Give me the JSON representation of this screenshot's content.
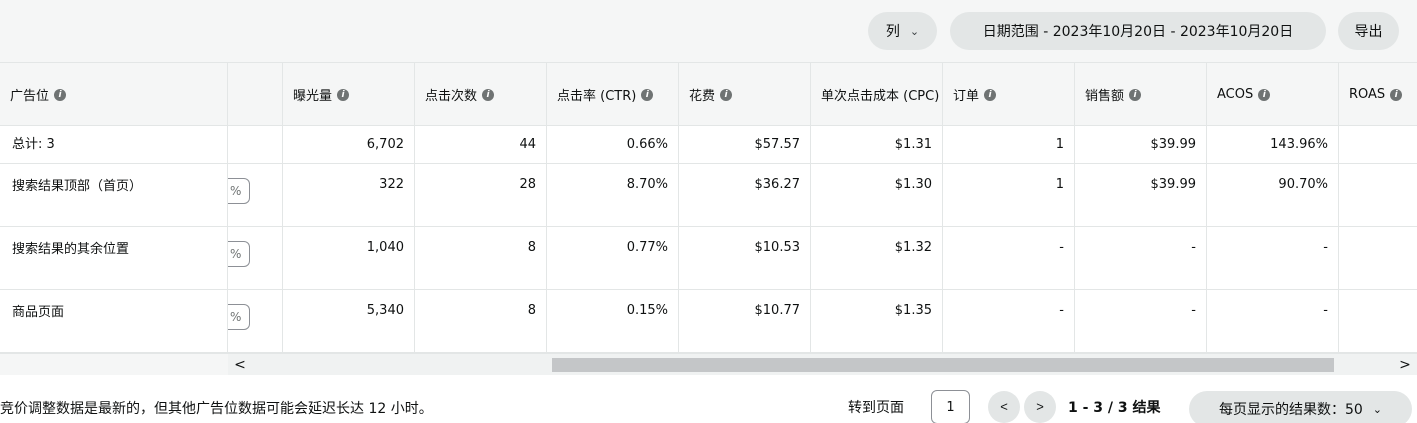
{
  "toolbar": {
    "columns_label": "列",
    "date_range_label": "日期范围 - 2023年10月20日 - 2023年10月20日",
    "export_label": "导出"
  },
  "table": {
    "headers": [
      "广告位",
      "",
      "曝光量",
      "点击次数",
      "点击率 (CTR)",
      "花费",
      "单次点击成本 (CPC)",
      "订单",
      "销售额",
      "ACOS",
      "ROAS"
    ],
    "total": {
      "label": "总计: 3",
      "values": [
        "6,702",
        "44",
        "0.66%",
        "$57.57",
        "$1.31",
        "1",
        "$39.99",
        "143.96%",
        ""
      ]
    },
    "rows": [
      {
        "placement": "搜索结果顶部（首页）",
        "bid_adjust": "%",
        "values": [
          "322",
          "28",
          "8.70%",
          "$36.27",
          "$1.30",
          "1",
          "$39.99",
          "90.70%",
          ""
        ]
      },
      {
        "placement": "搜索结果的其余位置",
        "bid_adjust": "%",
        "values": [
          "1,040",
          "8",
          "0.77%",
          "$10.53",
          "$1.32",
          "-",
          "-",
          "-",
          ""
        ]
      },
      {
        "placement": "商品页面",
        "bid_adjust": "%",
        "values": [
          "5,340",
          "8",
          "0.15%",
          "$10.77",
          "$1.35",
          "-",
          "-",
          "-",
          ""
        ]
      }
    ]
  },
  "scroll": {
    "left_arrow": "<",
    "right_arrow": ">"
  },
  "footer": {
    "note": "竞价调整数据是最新的，但其他广告位数据可能会延迟长达 12 小时。",
    "goto_label": "转到页面",
    "page_value": "1",
    "prev": "<",
    "next": ">",
    "results": "1 - 3 / 3 结果",
    "per_page": "每页显示的结果数：50"
  },
  "icons": {
    "info": "info-icon",
    "chevron": "chevron-down-icon"
  }
}
